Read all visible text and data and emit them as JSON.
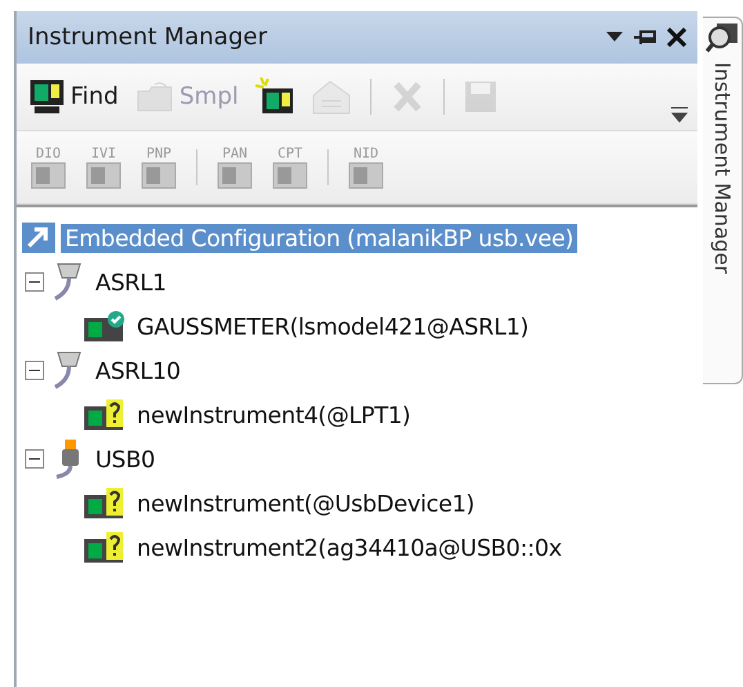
{
  "panel": {
    "title": "Instrument Manager"
  },
  "toolbar": [
    {
      "kind": "button",
      "label": "Find",
      "disabled": false
    },
    {
      "kind": "button",
      "label": "Smpl",
      "disabled": true
    },
    {
      "kind": "button",
      "disabled": false
    },
    {
      "kind": "button",
      "disabled": true
    },
    {
      "kind": "separator"
    },
    {
      "kind": "button",
      "disabled": true
    },
    {
      "kind": "separator"
    },
    {
      "kind": "button",
      "disabled": true
    }
  ],
  "driver_toolbar": [
    {
      "kind": "button",
      "label": "DIO"
    },
    {
      "kind": "button",
      "label": "IVI"
    },
    {
      "kind": "button",
      "label": "PNP"
    },
    {
      "kind": "separator"
    },
    {
      "kind": "button",
      "label": "PAN"
    },
    {
      "kind": "button",
      "label": "CPT"
    },
    {
      "kind": "separator"
    },
    {
      "kind": "button",
      "label": "NID"
    }
  ],
  "tree": {
    "label": "Embedded Configuration (malanikBP usb.vee)",
    "selected": true,
    "children": [
      {
        "label": "ASRL1",
        "kind": "serial",
        "expanded": true,
        "children": [
          {
            "label": "GAUSSMETER(lsmodel421@ASRL1)",
            "verified": true
          }
        ]
      },
      {
        "label": "ASRL10",
        "kind": "serial",
        "expanded": true,
        "children": [
          {
            "label": "newInstrument4(@LPT1)",
            "verified": false
          }
        ]
      },
      {
        "label": "USB0",
        "kind": "usb",
        "expanded": true,
        "children": [
          {
            "label": "newInstrument(@UsbDevice1)",
            "verified": false
          },
          {
            "label": "newInstrument2(ag34410a@USB0::0x",
            "verified": false
          }
        ]
      }
    ]
  },
  "side_tab": {
    "label": "Instrument Manager"
  }
}
